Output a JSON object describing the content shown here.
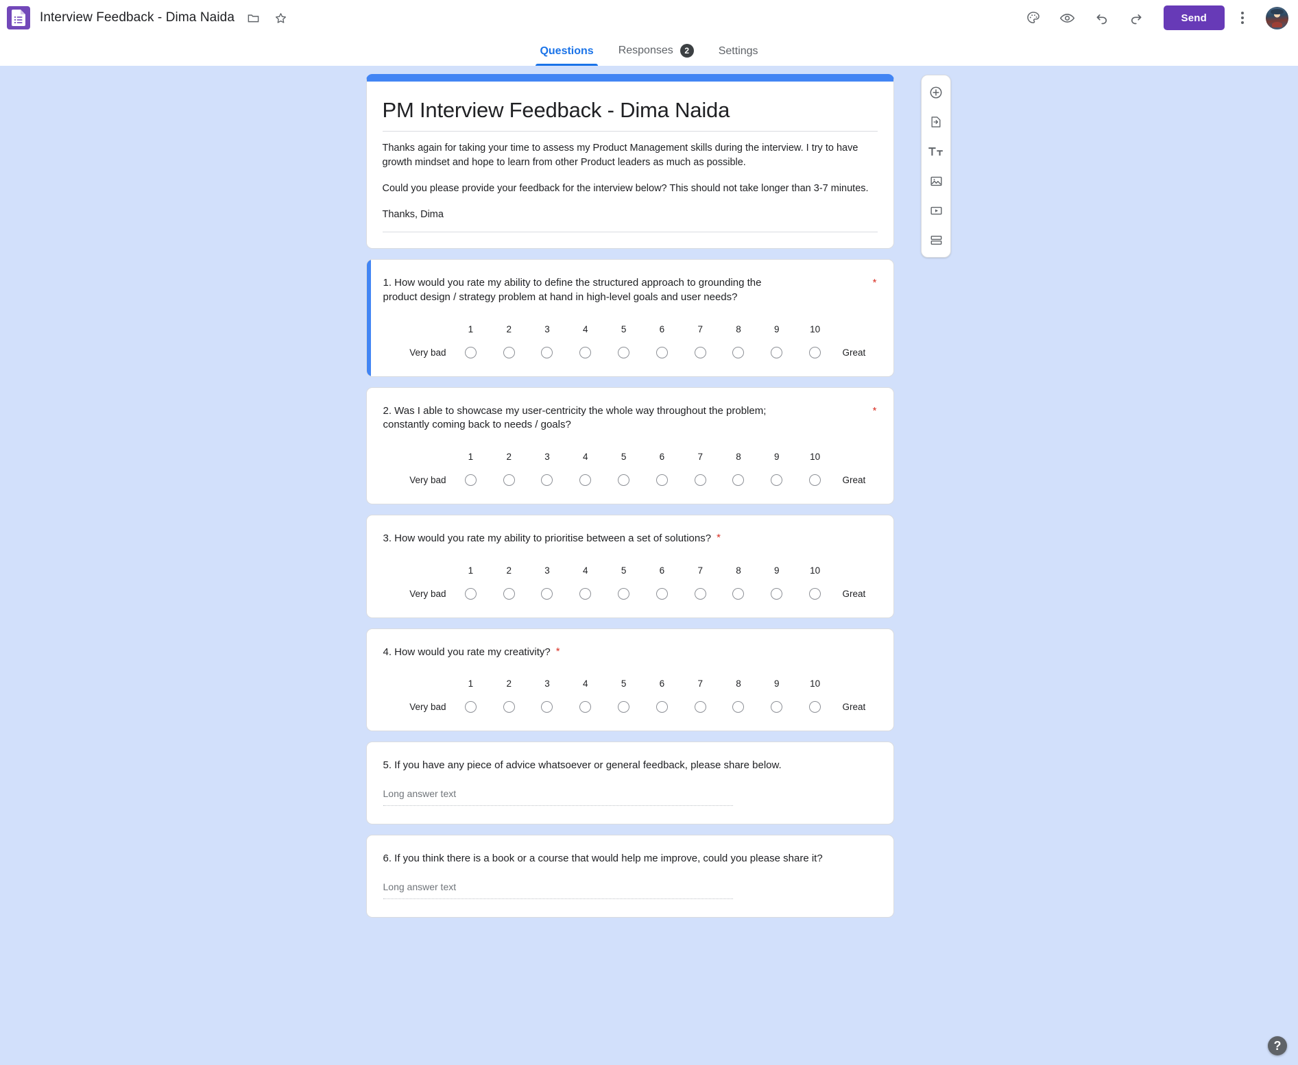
{
  "appbar": {
    "logo_icon": "google-forms-icon",
    "doc_title": "Interview Feedback - Dima Naida",
    "move_folder_icon": "folder-icon",
    "star_icon": "star-icon",
    "theme_icon": "palette-icon",
    "preview_icon": "eye-icon",
    "undo_icon": "undo-icon",
    "redo_icon": "redo-icon",
    "send_label": "Send",
    "more_icon": "kebab-menu-icon",
    "avatar_icon": "account-avatar"
  },
  "tabs": [
    {
      "label": "Questions",
      "active": true,
      "badge": null
    },
    {
      "label": "Responses",
      "active": false,
      "badge": "2"
    },
    {
      "label": "Settings",
      "active": false,
      "badge": null
    }
  ],
  "form_header": {
    "title": "PM Interview Feedback - Dima Naida",
    "description_paragraphs": [
      "Thanks again for taking your time to assess my Product Management skills during the interview. I try to have growth mindset and hope to learn from other Product leaders as much as possible.",
      "Could you please provide your feedback for the interview below? This should not take longer than 3-7 minutes.",
      "Thanks, Dima"
    ]
  },
  "scale": {
    "numbers": [
      "1",
      "2",
      "3",
      "4",
      "5",
      "6",
      "7",
      "8",
      "9",
      "10"
    ],
    "low_label": "Very bad",
    "high_label": "Great"
  },
  "questions": [
    {
      "text": "1. How would you rate my ability to define the structured approach to grounding the product design / strategy problem at hand in high-level goals and user needs?",
      "required_mark": "*",
      "type": "linear-scale",
      "selected": true,
      "star_position": "far"
    },
    {
      "text": "2. Was I able to showcase my user-centricity the whole way throughout the problem; constantly coming back to needs / goals?",
      "required_mark": "*",
      "type": "linear-scale",
      "selected": false,
      "star_position": "far"
    },
    {
      "text": "3. How would you rate my ability to prioritise between a set of solutions?",
      "required_mark": "*",
      "type": "linear-scale",
      "selected": false,
      "star_position": "near"
    },
    {
      "text": "4. How would you rate my creativity?",
      "required_mark": "*",
      "type": "linear-scale",
      "selected": false,
      "star_position": "near"
    },
    {
      "text": "5. If you have any piece of advice whatsoever or general feedback, please share below.",
      "required_mark": "",
      "type": "long-answer",
      "answer_placeholder": "Long answer text",
      "selected": false,
      "star_position": "none"
    },
    {
      "text": "6. If you think there is a book or a course that would help me improve, could you please share it?",
      "required_mark": "",
      "type": "long-answer",
      "answer_placeholder": "Long answer text",
      "selected": false,
      "star_position": "none"
    }
  ],
  "side_toolbar": [
    {
      "icon": "add-question-icon"
    },
    {
      "icon": "import-questions-icon"
    },
    {
      "icon": "add-title-and-description-icon"
    },
    {
      "icon": "add-image-icon"
    },
    {
      "icon": "add-video-icon"
    },
    {
      "icon": "add-section-icon"
    }
  ],
  "help": {
    "label": "?"
  },
  "colors": {
    "canvas_background": "#d2e0fb",
    "header_accent": "#4285f4",
    "send_button": "#673ab7",
    "active_tab": "#1a73e8",
    "required_star": "#d93025",
    "logo_purple": "#7248b9"
  }
}
